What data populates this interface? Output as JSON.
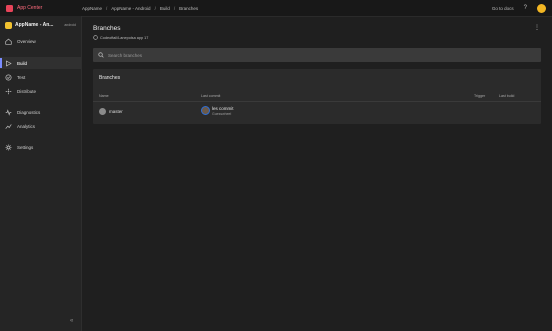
{
  "topbar": {
    "brand": "App Center",
    "breadcrumbs": [
      "AppName",
      "AppName - Android",
      "Build",
      "Branches"
    ],
    "go_to_docs": "Go to docs",
    "help": "?"
  },
  "sidebar": {
    "app_name": "AppName - An...",
    "app_badge": "android",
    "items": [
      {
        "label": "Overview",
        "icon": "home-icon"
      },
      {
        "label": "Build",
        "icon": "play-icon",
        "active": true
      },
      {
        "label": "Test",
        "icon": "check-icon"
      },
      {
        "label": "Distribute",
        "icon": "share-icon"
      },
      {
        "label": "Diagnostics",
        "icon": "diagnostics-icon"
      },
      {
        "label": "Analytics",
        "icon": "analytics-icon"
      },
      {
        "label": "Settings",
        "icon": "gear-icon"
      }
    ],
    "collapse": "«"
  },
  "main": {
    "title": "Branches",
    "repo": "Codeoftail/Lanepolsa app 17",
    "search_placeholder": "Search branches",
    "card_title": "Branches",
    "columns": [
      "Name",
      "Last commit",
      "Trigger",
      "Last build"
    ],
    "rows": [
      {
        "name": "master",
        "commit_message": "les commit",
        "commit_author": "Guesswheel"
      }
    ]
  },
  "colors": {
    "accent": "#7a8cff",
    "brand": "#e8445a",
    "app_icon": "#f2c230",
    "avatar": "#f2b623"
  }
}
